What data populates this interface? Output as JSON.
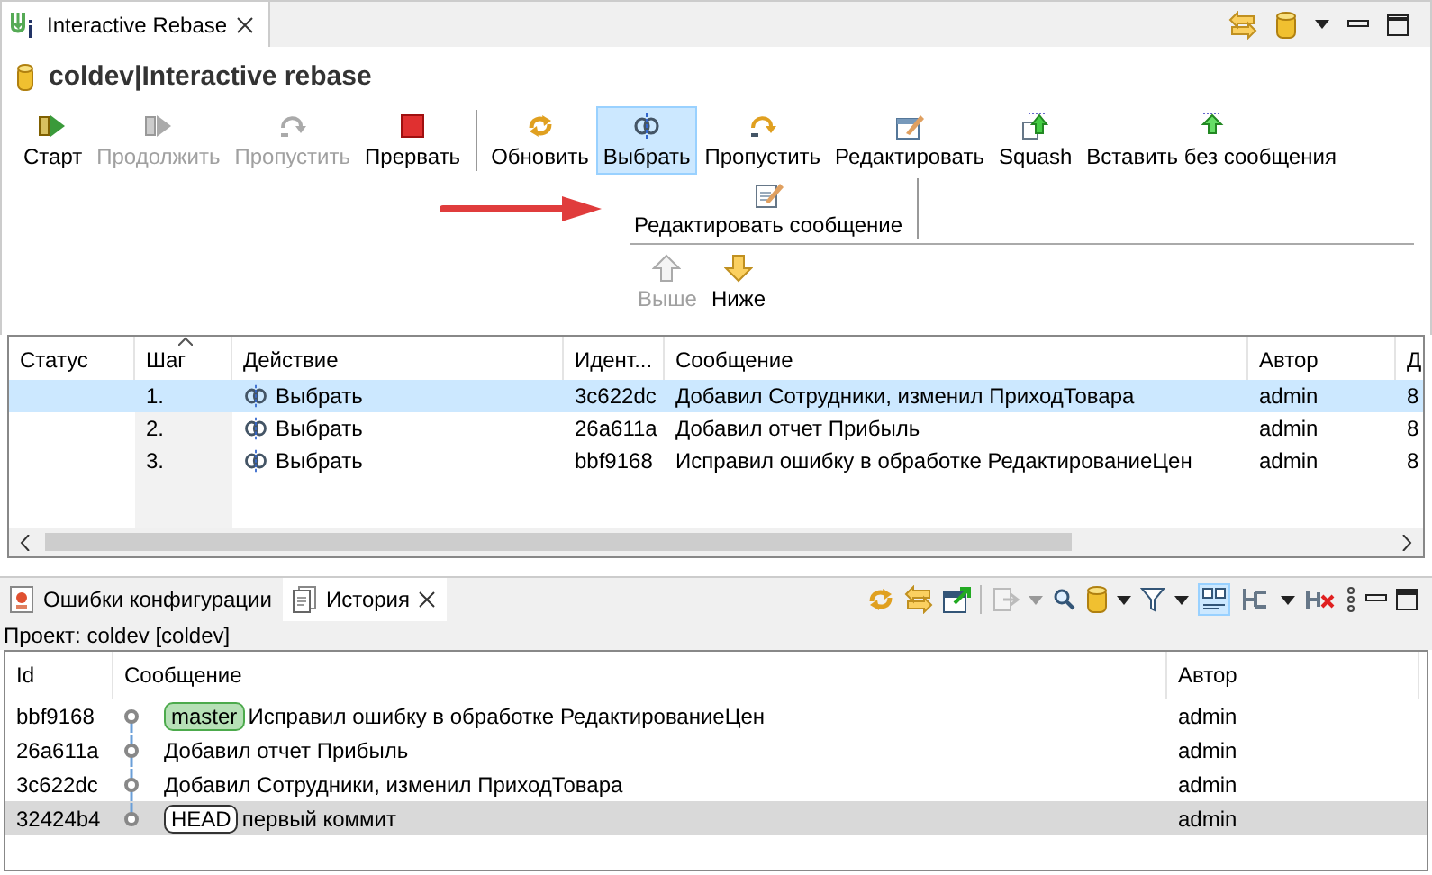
{
  "editor_tab": {
    "title": "Interactive Rebase"
  },
  "title": "coldev|Interactive rebase",
  "toolbar": {
    "row1": [
      {
        "kind": "button",
        "label": "Старт",
        "disabled": false,
        "selected": false
      },
      {
        "kind": "button",
        "label": "Продолжить",
        "disabled": true,
        "selected": false
      },
      {
        "kind": "button",
        "label": "Пропустить",
        "disabled": true,
        "selected": false
      },
      {
        "kind": "button",
        "label": "Прервать",
        "disabled": false,
        "selected": false
      },
      {
        "kind": "separator"
      },
      {
        "kind": "button",
        "label": "Обновить",
        "disabled": false,
        "selected": false
      },
      {
        "kind": "button",
        "label": "Выбрать",
        "disabled": false,
        "selected": true
      },
      {
        "kind": "button",
        "label": "Пропустить",
        "disabled": false,
        "selected": false
      },
      {
        "kind": "button",
        "label": "Редактировать",
        "disabled": false,
        "selected": false
      },
      {
        "kind": "button",
        "label": "Squash",
        "disabled": false,
        "selected": false
      },
      {
        "kind": "button",
        "label": "Вставить без сообщения",
        "disabled": false,
        "selected": false
      }
    ],
    "row2": [
      {
        "kind": "button",
        "label": "Редактировать сообщение",
        "disabled": false,
        "selected": false
      },
      {
        "kind": "separator"
      }
    ],
    "row3": [
      {
        "kind": "button",
        "label": "Выше",
        "disabled": true,
        "selected": false
      },
      {
        "kind": "button",
        "label": "Ниже",
        "disabled": false,
        "selected": false
      }
    ]
  },
  "rebase_table": {
    "columns": [
      "Статус",
      "Шаг",
      "Действие",
      "Идент...",
      "Сообщение",
      "Автор",
      "Д"
    ],
    "rows": [
      {
        "step": "1.",
        "action": "Выбрать",
        "id": "3c622dc",
        "message": "Добавил Сотрудники, изменил ПриходТовара",
        "author": "admin",
        "column_7": "8",
        "selected": true
      },
      {
        "step": "2.",
        "action": "Выбрать",
        "id": "26a611a",
        "message": "Добавил отчет Прибыль",
        "author": "admin",
        "column_7": "8",
        "selected": false
      },
      {
        "step": "3.",
        "action": "Выбрать",
        "id": "bbf9168",
        "message": "Исправил ошибку в обработке РедактированиеЦен",
        "author": "admin",
        "column_7": "8",
        "selected": false
      }
    ]
  },
  "bottom_tabs": [
    {
      "label": "Ошибки конфигурации",
      "selected": false
    },
    {
      "label": "История",
      "selected": true
    }
  ],
  "project_label": "Проект: coldev [coldev]",
  "history_table": {
    "columns": [
      "Id",
      "Сообщение",
      "Автор"
    ],
    "rows": [
      {
        "id": "bbf9168",
        "ref": {
          "label": "master",
          "kind": "branch"
        },
        "message": "Исправил ошибку в обработке РедактированиеЦен",
        "author": "admin",
        "selected": false
      },
      {
        "id": "26a611a",
        "message": "Добавил отчет Прибыль",
        "author": "admin",
        "selected": false
      },
      {
        "id": "3c622dc",
        "message": "Добавил Сотрудники, изменил ПриходТовара",
        "author": "admin",
        "selected": false
      },
      {
        "id": "32424b4",
        "ref": {
          "label": "HEAD",
          "kind": "head"
        },
        "message": "первый коммит",
        "author": "admin",
        "selected": true
      }
    ]
  }
}
